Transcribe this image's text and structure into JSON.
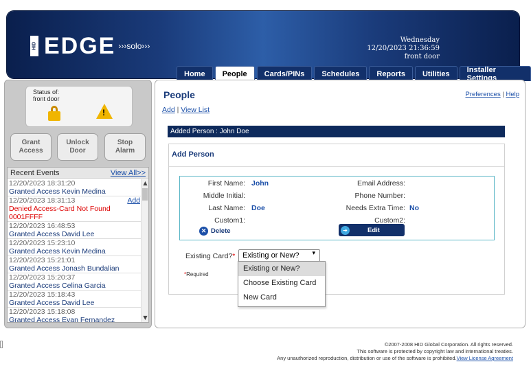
{
  "header": {
    "logo": {
      "brand": "HID",
      "product": "EDGE",
      "edition": "solo"
    },
    "date_line1": "Wednesday",
    "date_line2": "12/20/2023 21:36:59",
    "date_line3": "front door"
  },
  "tabs": [
    {
      "label": "Home"
    },
    {
      "label": "People",
      "active": true
    },
    {
      "label": "Cards/PINs"
    },
    {
      "label": "Schedules"
    },
    {
      "label": "Reports"
    },
    {
      "label": "Utilities"
    },
    {
      "label": "Installer Settings"
    }
  ],
  "status": {
    "title_line1": "Status of:",
    "title_line2": "front door",
    "icons": [
      "lock-icon",
      "warning-icon"
    ]
  },
  "actions": {
    "grant_l1": "Grant",
    "grant_l2": "Access",
    "unlock_l1": "Unlock",
    "unlock_l2": "Door",
    "stop_l1": "Stop",
    "stop_l2": "Alarm"
  },
  "recent_events": {
    "title": "Recent Events",
    "view_all": "View All>>",
    "add_label": "Add",
    "items": [
      {
        "time": "12/20/2023 18:31:20",
        "desc": "Granted Access Kevin Medina"
      },
      {
        "time": "12/20/2023 18:31:13",
        "desc": "Denied Access-Card Not Found 0001FFFF",
        "denied": true
      },
      {
        "time": "12/20/2023 16:48:53",
        "desc": "Granted Access David Lee"
      },
      {
        "time": "12/20/2023 15:23:10",
        "desc": "Granted Access Kevin Medina"
      },
      {
        "time": "12/20/2023 15:21:01",
        "desc": "Granted Access Jonash Bundalian"
      },
      {
        "time": "12/20/2023 15:20:37",
        "desc": "Granted Access Celina Garcia"
      },
      {
        "time": "12/20/2023 15:18:43",
        "desc": "Granted Access David Lee"
      },
      {
        "time": "12/20/2023 15:18:08",
        "desc": "Granted Access Evan Fernandez"
      }
    ]
  },
  "main": {
    "title": "People",
    "link_add": "Add",
    "link_sep": "|",
    "link_view": "View List",
    "link_prefs": "Preferences",
    "link_help": "Help",
    "added_msg": "Added Person : John Doe",
    "form_title": "Add Person"
  },
  "person": {
    "first_name_label": "First Name:",
    "first_name": "John",
    "middle_initial_label": "Middle Initial:",
    "middle_initial": "",
    "last_name_label": "Last Name:",
    "last_name": "Doe",
    "custom1_label": "Custom1:",
    "custom1": "",
    "email_label": "Email Address:",
    "email": "",
    "phone_label": "Phone Number:",
    "phone": "",
    "extra_time_label": "Needs Extra Time:",
    "extra_time": "No",
    "custom2_label": "Custom2:",
    "custom2": "",
    "delete_label": "Delete",
    "edit_label": "Edit"
  },
  "existing_card": {
    "label": "Existing Card?",
    "required_mark": "*",
    "selected": "Existing or New?",
    "options": [
      "Existing or New?",
      "Choose Existing Card",
      "New Card"
    ],
    "required_note": "Required"
  },
  "footer": {
    "line1": "©2007-2008 HID Global Corporation. All rights reserved.",
    "line2": "This software is protected by copyright law and international treaties.",
    "line3": "Any unauthorized reproduction, distribution or use of the software is prohibited.",
    "license_link": "View License Agreement"
  }
}
